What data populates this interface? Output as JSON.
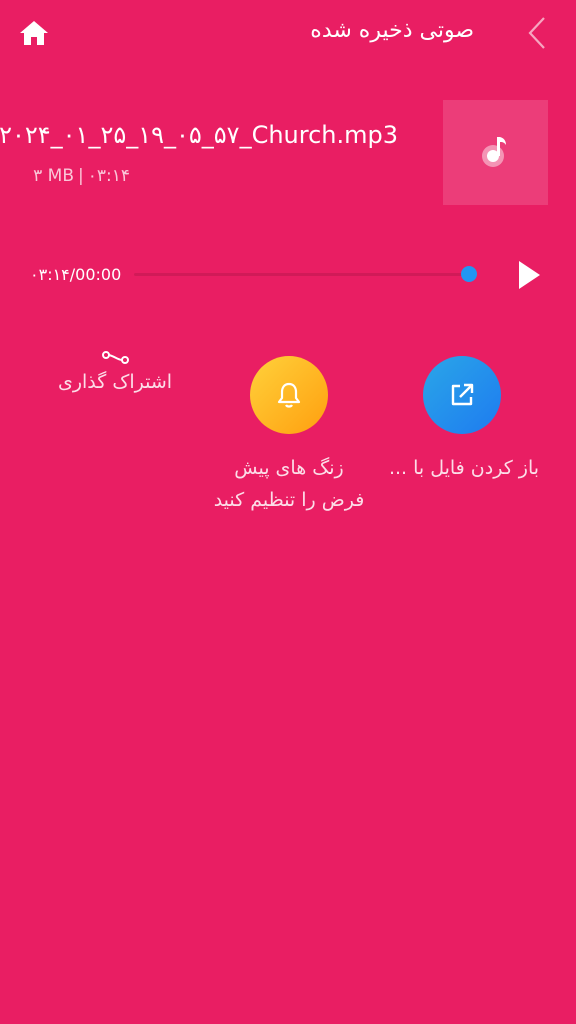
{
  "header": {
    "title": "صوتی ذخیره شده",
    "home_icon": "home-icon",
    "back_icon": "chevron-left-icon"
  },
  "file": {
    "name": "۲۰۲۴_۰۱_۲۵_۱۹_۰۵_۵۷_Church.mp3",
    "size": "۳ MB",
    "duration": "۰۳:۱۴",
    "thumbnail_icon": "music-note-icon"
  },
  "player": {
    "time_display": "۰۳:۱۴/00:00",
    "progress_fraction": 1.0,
    "play_icon": "play-icon"
  },
  "actions": {
    "open_with": {
      "label": "باز کردن فایل با ...",
      "icon": "external-link-icon",
      "color": "#2196F3"
    },
    "set_ringtone": {
      "label_line1": "زنگ های پیش",
      "label_line2": "فرض را تنظیم کنید",
      "icon": "bell-icon",
      "color": "#FFB300"
    },
    "share": {
      "label": "اشتراک گذاری",
      "icon": "share-icon"
    }
  },
  "colors": {
    "background": "#E91E63",
    "accent": "#2196F3"
  }
}
